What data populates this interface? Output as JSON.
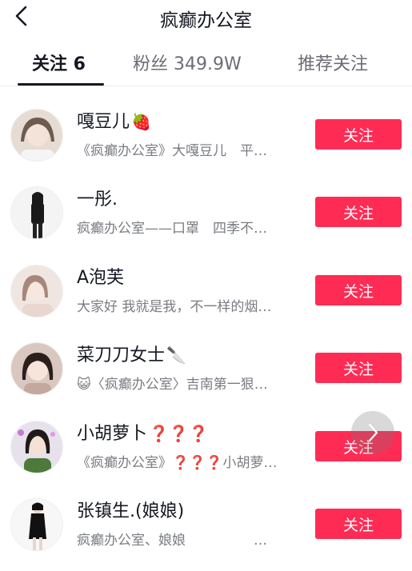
{
  "header": {
    "title": "疯癫办公室",
    "back_icon": "back-arrow-icon"
  },
  "tabs": [
    {
      "label": "关注 6",
      "active": true
    },
    {
      "label": "粉丝 349.9W",
      "active": false
    },
    {
      "label": "推荐关注",
      "active": false
    }
  ],
  "accent_color": "#fe2c55",
  "users": [
    {
      "name": "嘎豆儿",
      "emoji": "🍓",
      "desc": "《疯癫办公室》大嘎豆儿　平…",
      "button": "关注"
    },
    {
      "name": "一彤.",
      "emoji": "",
      "desc": "疯癫办公室——口罩　四季不…",
      "button": "关注"
    },
    {
      "name": "A泡芙",
      "emoji": "",
      "desc": "大家好 我就是我，不一样的烟…",
      "button": "关注"
    },
    {
      "name": "菜刀刀女士",
      "emoji": "🔪",
      "desc": "😺〈疯癫办公室〉吉南第一狠…",
      "button": "关注"
    },
    {
      "name": "小胡萝卜",
      "emoji": "❓❓❓",
      "desc": "《疯癫办公室》❓❓❓小胡萝…",
      "button": "关注"
    },
    {
      "name": "张镇生.(娘娘)",
      "emoji": "",
      "desc": "疯癫办公室、娘娘　　　　　…",
      "button": "关注"
    }
  ],
  "floating_button_icon": "chevron-right-icon"
}
